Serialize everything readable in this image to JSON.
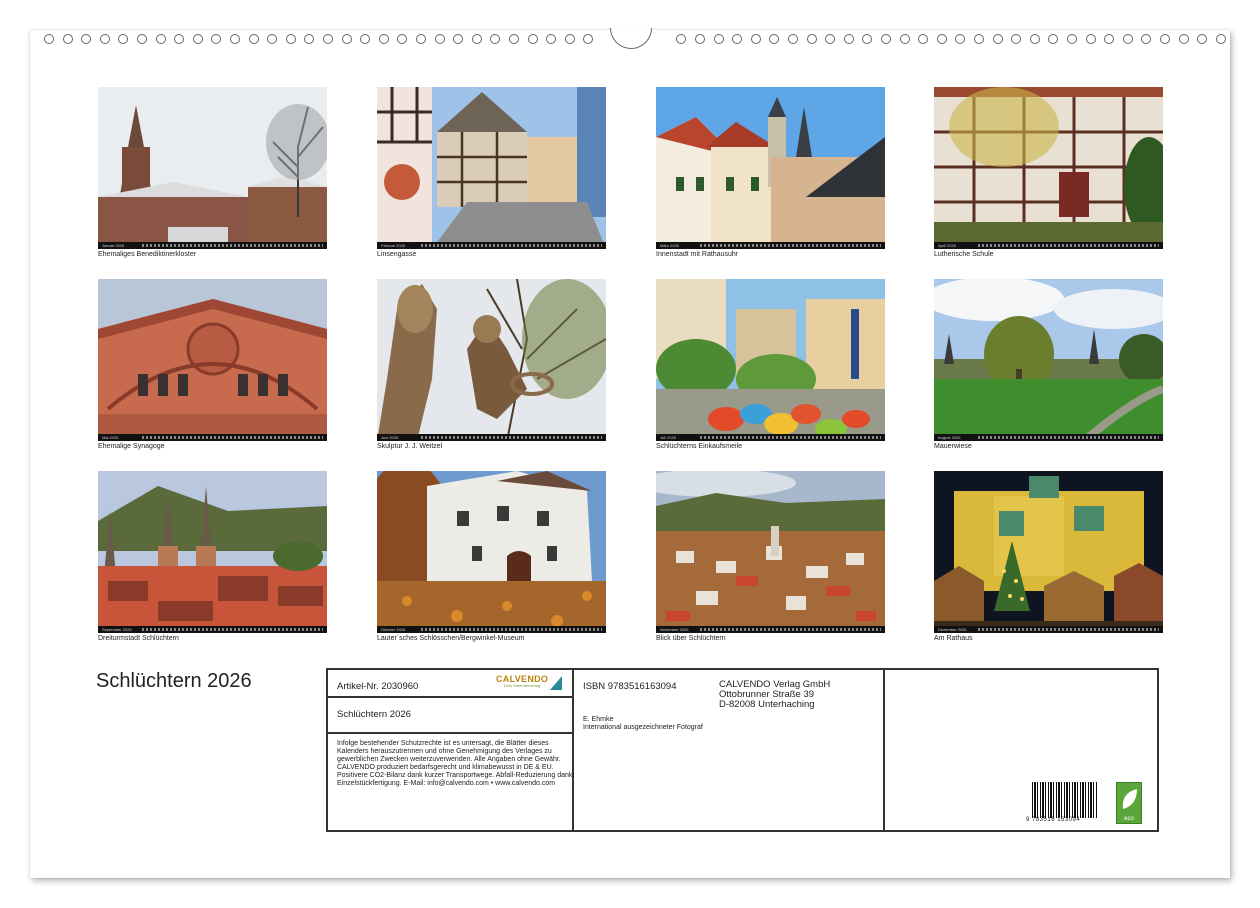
{
  "calendar": {
    "title": "Schlüchtern 2026",
    "months": [
      {
        "caption": "Ehemaliges Benediktinerkloster",
        "label": "Januar 2026"
      },
      {
        "caption": "Linsengasse",
        "label": "Februar 2026"
      },
      {
        "caption": "Innenstadt mit Rathausuhr",
        "label": "März 2026"
      },
      {
        "caption": "Lutherische Schule",
        "label": "April 2026"
      },
      {
        "caption": "Ehemalige Synagoge",
        "label": "Mai 2026"
      },
      {
        "caption": "Skulptur J. J. Weitzel",
        "label": "Juni 2026"
      },
      {
        "caption": "Schlüchterns Einkaufsmeile",
        "label": "Juli 2026"
      },
      {
        "caption": "Mauerwiese",
        "label": "August 2026"
      },
      {
        "caption": "Dreiturmstadt Schlüchtern",
        "label": "September 2026"
      },
      {
        "caption": "Lauter´sches Schlösschen/Bergwinkel-Museum",
        "label": "Oktober 2026"
      },
      {
        "caption": "Blick über Schlüchtern",
        "label": "November 2026"
      },
      {
        "caption": "Am Rathaus",
        "label": "Dezember 2026"
      }
    ]
  },
  "info": {
    "article": "Artikel-Nr. 2030960",
    "logo_text": "CALVENDO",
    "logo_sub": "Dein Kalenderverlag",
    "title": "Schlüchtern 2026",
    "notice": "Infolge bestehender Schutzrechte ist es untersagt, die Blätter dieses Kalenders herauszutrennen und ohne Genehmigung des Verlages zu gewerblichen Zwecken weiterzuverwenden. Alle Angaben ohne Gewähr. CALVENDO produziert bedarfsgerecht und klimabewusst in DE & EU. Positivere CO2-Bilanz dank kurzer Transportwege. Abfall-Reduzierung dank Einzelstückfertigung. E-Mail: info@calvendo.com • www.calvendo.com",
    "isbn": "ISBN 9783516163094",
    "publisher": [
      "CALVENDO Verlag GmbH",
      "Ottobrunner Straße 39",
      "D-82008 Unterhaching"
    ],
    "author": "E. Ehmke",
    "author_note": "International ausgezeichneter Fotograf",
    "barcode_number": "9 783516 163094",
    "eco_label": "eco"
  },
  "colors": {
    "frame": "#333333",
    "sheet": "#ffffff",
    "eco": "#5aa63a"
  }
}
